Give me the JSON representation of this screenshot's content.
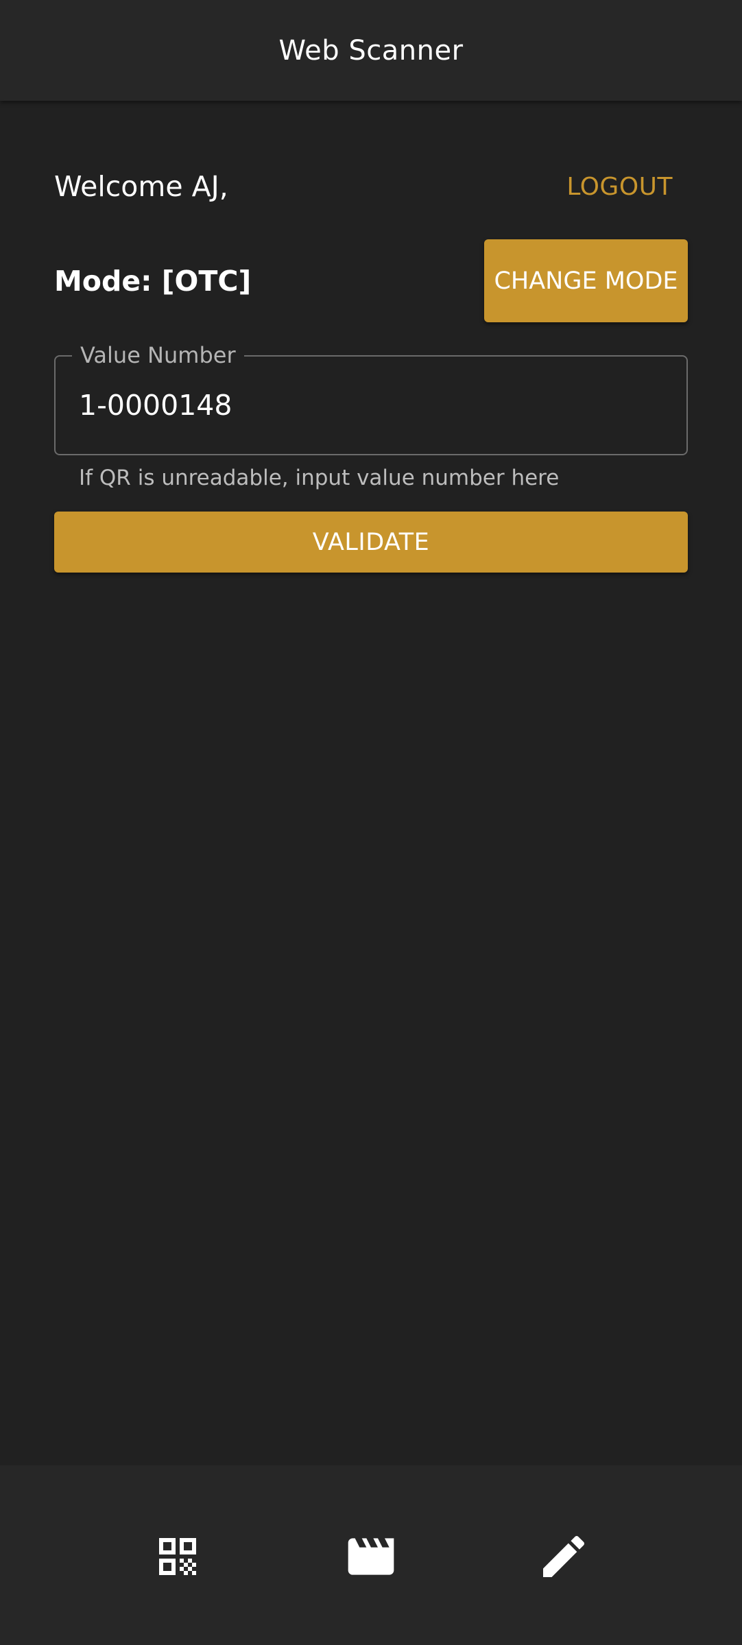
{
  "app_bar": {
    "title": "Web Scanner"
  },
  "user": {
    "welcome_text": "Welcome AJ,",
    "logout_label": "LOGOUT"
  },
  "mode": {
    "text": "Mode: [OTC]",
    "change_label": "CHANGE MODE"
  },
  "value_field": {
    "label": "Value Number",
    "value": "1-0000148",
    "helper": "If QR is unreadable, input value number here"
  },
  "validate": {
    "label": "VALIDATE"
  },
  "bottom_nav": {
    "items": [
      {
        "icon": "qr-code-icon"
      },
      {
        "icon": "movie-clapper-icon"
      },
      {
        "icon": "pencil-edit-icon"
      }
    ]
  },
  "colors": {
    "accent": "#c8952d",
    "background": "#212121",
    "bar": "#272727",
    "text": "#ffffff"
  }
}
